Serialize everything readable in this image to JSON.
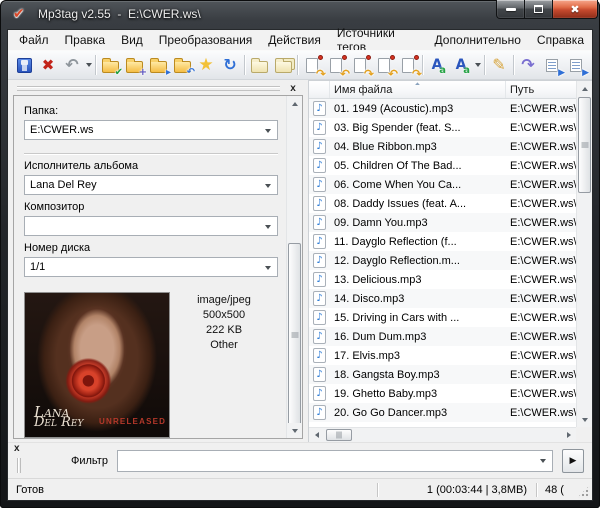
{
  "window": {
    "title": "Mp3tag v2.55  -  E:\\CWER.ws\\"
  },
  "icons": {
    "app_logo": "✔",
    "window_close": "✖",
    "close_small": "x",
    "sort_asc": "▲",
    "filter_apply": "▶"
  },
  "menu": {
    "items": [
      {
        "id": "file",
        "label": "Файл"
      },
      {
        "id": "edit",
        "label": "Правка"
      },
      {
        "id": "view",
        "label": "Вид"
      },
      {
        "id": "convert",
        "label": "Преобразования"
      },
      {
        "id": "actions",
        "label": "Действия"
      },
      {
        "id": "tag-sources",
        "label": "Источники тегов"
      },
      {
        "id": "tools",
        "label": "Дополнительно"
      },
      {
        "id": "help",
        "label": "Справка"
      }
    ]
  },
  "toolbar": {
    "items": [
      {
        "name": "save-tag-icon",
        "type": "floppy"
      },
      {
        "name": "remove-tag-icon",
        "type": "glyph",
        "glyph": "✖",
        "color": "#c2241a",
        "size": 15,
        "bold": true
      },
      {
        "name": "undo-icon",
        "type": "glyph",
        "glyph": "↶",
        "color": "#8f969c",
        "size": 16,
        "bold": true
      },
      {
        "name": "undo-dropdown-icon",
        "type": "dd"
      },
      {
        "type": "sep"
      },
      {
        "name": "change-directory-icon",
        "type": "folder",
        "badge": "✔",
        "badge_color": "#1e9e3e"
      },
      {
        "name": "add-directory-icon",
        "type": "folder",
        "badge": "+",
        "badge_color": "#5b54c0"
      },
      {
        "name": "favorite-directory-icon",
        "type": "folder",
        "badge": "▸",
        "badge_color": "#2f6fd6"
      },
      {
        "name": "parent-directory-icon",
        "type": "folder",
        "badge": "↶",
        "badge_color": "#2f6fd6"
      },
      {
        "name": "favorites-star-icon",
        "type": "glyph",
        "glyph": "★",
        "color": "#f2c138",
        "size": 17
      },
      {
        "name": "refresh-icon",
        "type": "glyph",
        "glyph": "↻",
        "color": "#2f6fd6",
        "size": 16,
        "bold": true
      },
      {
        "type": "sep"
      },
      {
        "name": "open-folder-icon",
        "type": "folder",
        "pale": true
      },
      {
        "name": "copy-folders-icon",
        "type": "folder",
        "pale": true,
        "stack": true
      },
      {
        "type": "sep"
      },
      {
        "name": "convert-tag-filename-icon",
        "type": "doc",
        "badge": "↷"
      },
      {
        "name": "convert-filename-tag-icon",
        "type": "doc",
        "badge": "↶"
      },
      {
        "name": "convert-filename-filename-icon",
        "type": "doc",
        "badge": "↷"
      },
      {
        "name": "convert-textfile-tag-icon",
        "type": "doc",
        "badge": "↶"
      },
      {
        "name": "convert-tag-tag-icon",
        "type": "doc",
        "badge": "↷"
      },
      {
        "type": "sep"
      },
      {
        "name": "case-conversion-icon",
        "type": "case",
        "glyph_a": "A",
        "glyph_b": "a"
      },
      {
        "name": "case-conversion-options-icon",
        "type": "case",
        "glyph_a": "A",
        "glyph_b": "a"
      },
      {
        "name": "case-dropdown-icon",
        "type": "dd"
      },
      {
        "type": "sep"
      },
      {
        "name": "edit-tag-icon",
        "type": "glyph",
        "glyph": "✎",
        "color": "#d7a43b",
        "size": 16
      },
      {
        "type": "sep"
      },
      {
        "name": "actions-icon",
        "type": "glyph",
        "glyph": "↷",
        "color": "#7a6fd0",
        "size": 16,
        "bold": true
      },
      {
        "name": "playlist-icon",
        "type": "plist",
        "badge": "▶"
      },
      {
        "name": "playlist-all-icon",
        "type": "plist",
        "badge": "▶"
      }
    ]
  },
  "tag_panel": {
    "folder": {
      "label": "Папка:",
      "value": "E:\\CWER.ws"
    },
    "album_artist": {
      "label": "Исполнитель альбома",
      "value": "Lana Del Rey"
    },
    "composer": {
      "label": "Композитор",
      "value": ""
    },
    "disc_number": {
      "label": "Номер диска",
      "value": "1/1"
    },
    "cover": {
      "format": "image/jpeg",
      "dimensions": "500x500",
      "filesize": "222 KB",
      "cover_type": "Other",
      "art_line1": "Lana",
      "art_line2": "Del Rey",
      "art_badge": "UNRELEASED"
    }
  },
  "files": {
    "header": {
      "name": "Имя файла",
      "path": "Путь"
    },
    "note_glyph": "♪",
    "rows": [
      {
        "name": "01. 1949 (Acoustic).mp3",
        "path": "E:\\CWER.ws\\"
      },
      {
        "name": "03. Big Spender (feat. S...",
        "path": "E:\\CWER.ws\\"
      },
      {
        "name": "04. Blue Ribbon.mp3",
        "path": "E:\\CWER.ws\\"
      },
      {
        "name": "05. Children Of The Bad...",
        "path": "E:\\CWER.ws\\"
      },
      {
        "name": "06. Come When You Ca...",
        "path": "E:\\CWER.ws\\"
      },
      {
        "name": "08. Daddy Issues (feat. A...",
        "path": "E:\\CWER.ws\\"
      },
      {
        "name": "09. Damn You.mp3",
        "path": "E:\\CWER.ws\\"
      },
      {
        "name": "11. Dayglo Reflection (f...",
        "path": "E:\\CWER.ws\\"
      },
      {
        "name": "12. Dayglo Reflection.m...",
        "path": "E:\\CWER.ws\\"
      },
      {
        "name": "13. Delicious.mp3",
        "path": "E:\\CWER.ws\\"
      },
      {
        "name": "14. Disco.mp3",
        "path": "E:\\CWER.ws\\"
      },
      {
        "name": "15. Driving in Cars with ...",
        "path": "E:\\CWER.ws\\"
      },
      {
        "name": "16. Dum Dum.mp3",
        "path": "E:\\CWER.ws\\"
      },
      {
        "name": "17. Elvis.mp3",
        "path": "E:\\CWER.ws\\"
      },
      {
        "name": "18. Gangsta Boy.mp3",
        "path": "E:\\CWER.ws\\"
      },
      {
        "name": "19. Ghetto Baby.mp3",
        "path": "E:\\CWER.ws\\"
      },
      {
        "name": "20. Go Go Dancer.mp3",
        "path": "E:\\CWER.ws\\"
      }
    ]
  },
  "filter": {
    "label": "Фильтр",
    "value": ""
  },
  "status": {
    "ready": "Готов",
    "selection": "1 (00:03:44 | 3,8MB)",
    "count": "48 ("
  }
}
